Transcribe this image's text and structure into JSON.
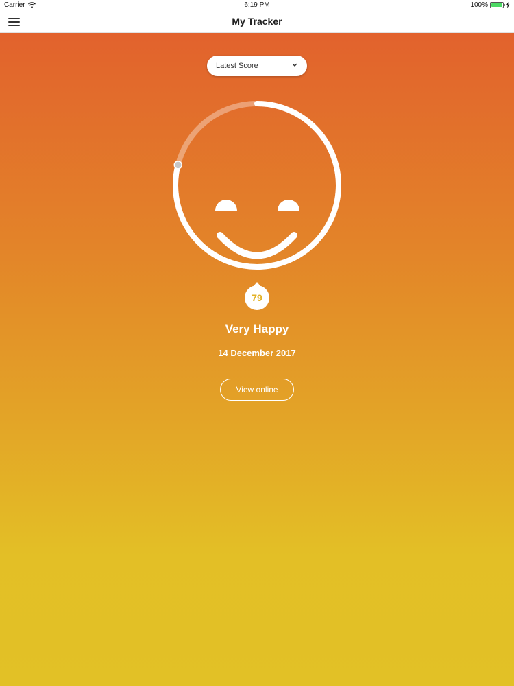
{
  "status_bar": {
    "carrier": "Carrier",
    "wifi_icon": "wifi-icon",
    "time": "6:19 PM",
    "battery_percent": "100%",
    "battery_level": 1.0,
    "charging_icon": "bolt-icon"
  },
  "nav": {
    "menu_icon": "hamburger-menu-icon",
    "title": "My Tracker"
  },
  "dropdown": {
    "selected": "Latest Score",
    "icon": "chevron-down-icon"
  },
  "score": {
    "value": "79",
    "max": 100,
    "fraction": 0.79,
    "face_icon": "smiley-face-icon"
  },
  "mood": "Very Happy",
  "date": "14 December 2017",
  "view_button": "View online",
  "colors": {
    "gradient_top": "#e2622d",
    "gradient_bottom": "#e2c126",
    "score_text": "#e3b227"
  }
}
